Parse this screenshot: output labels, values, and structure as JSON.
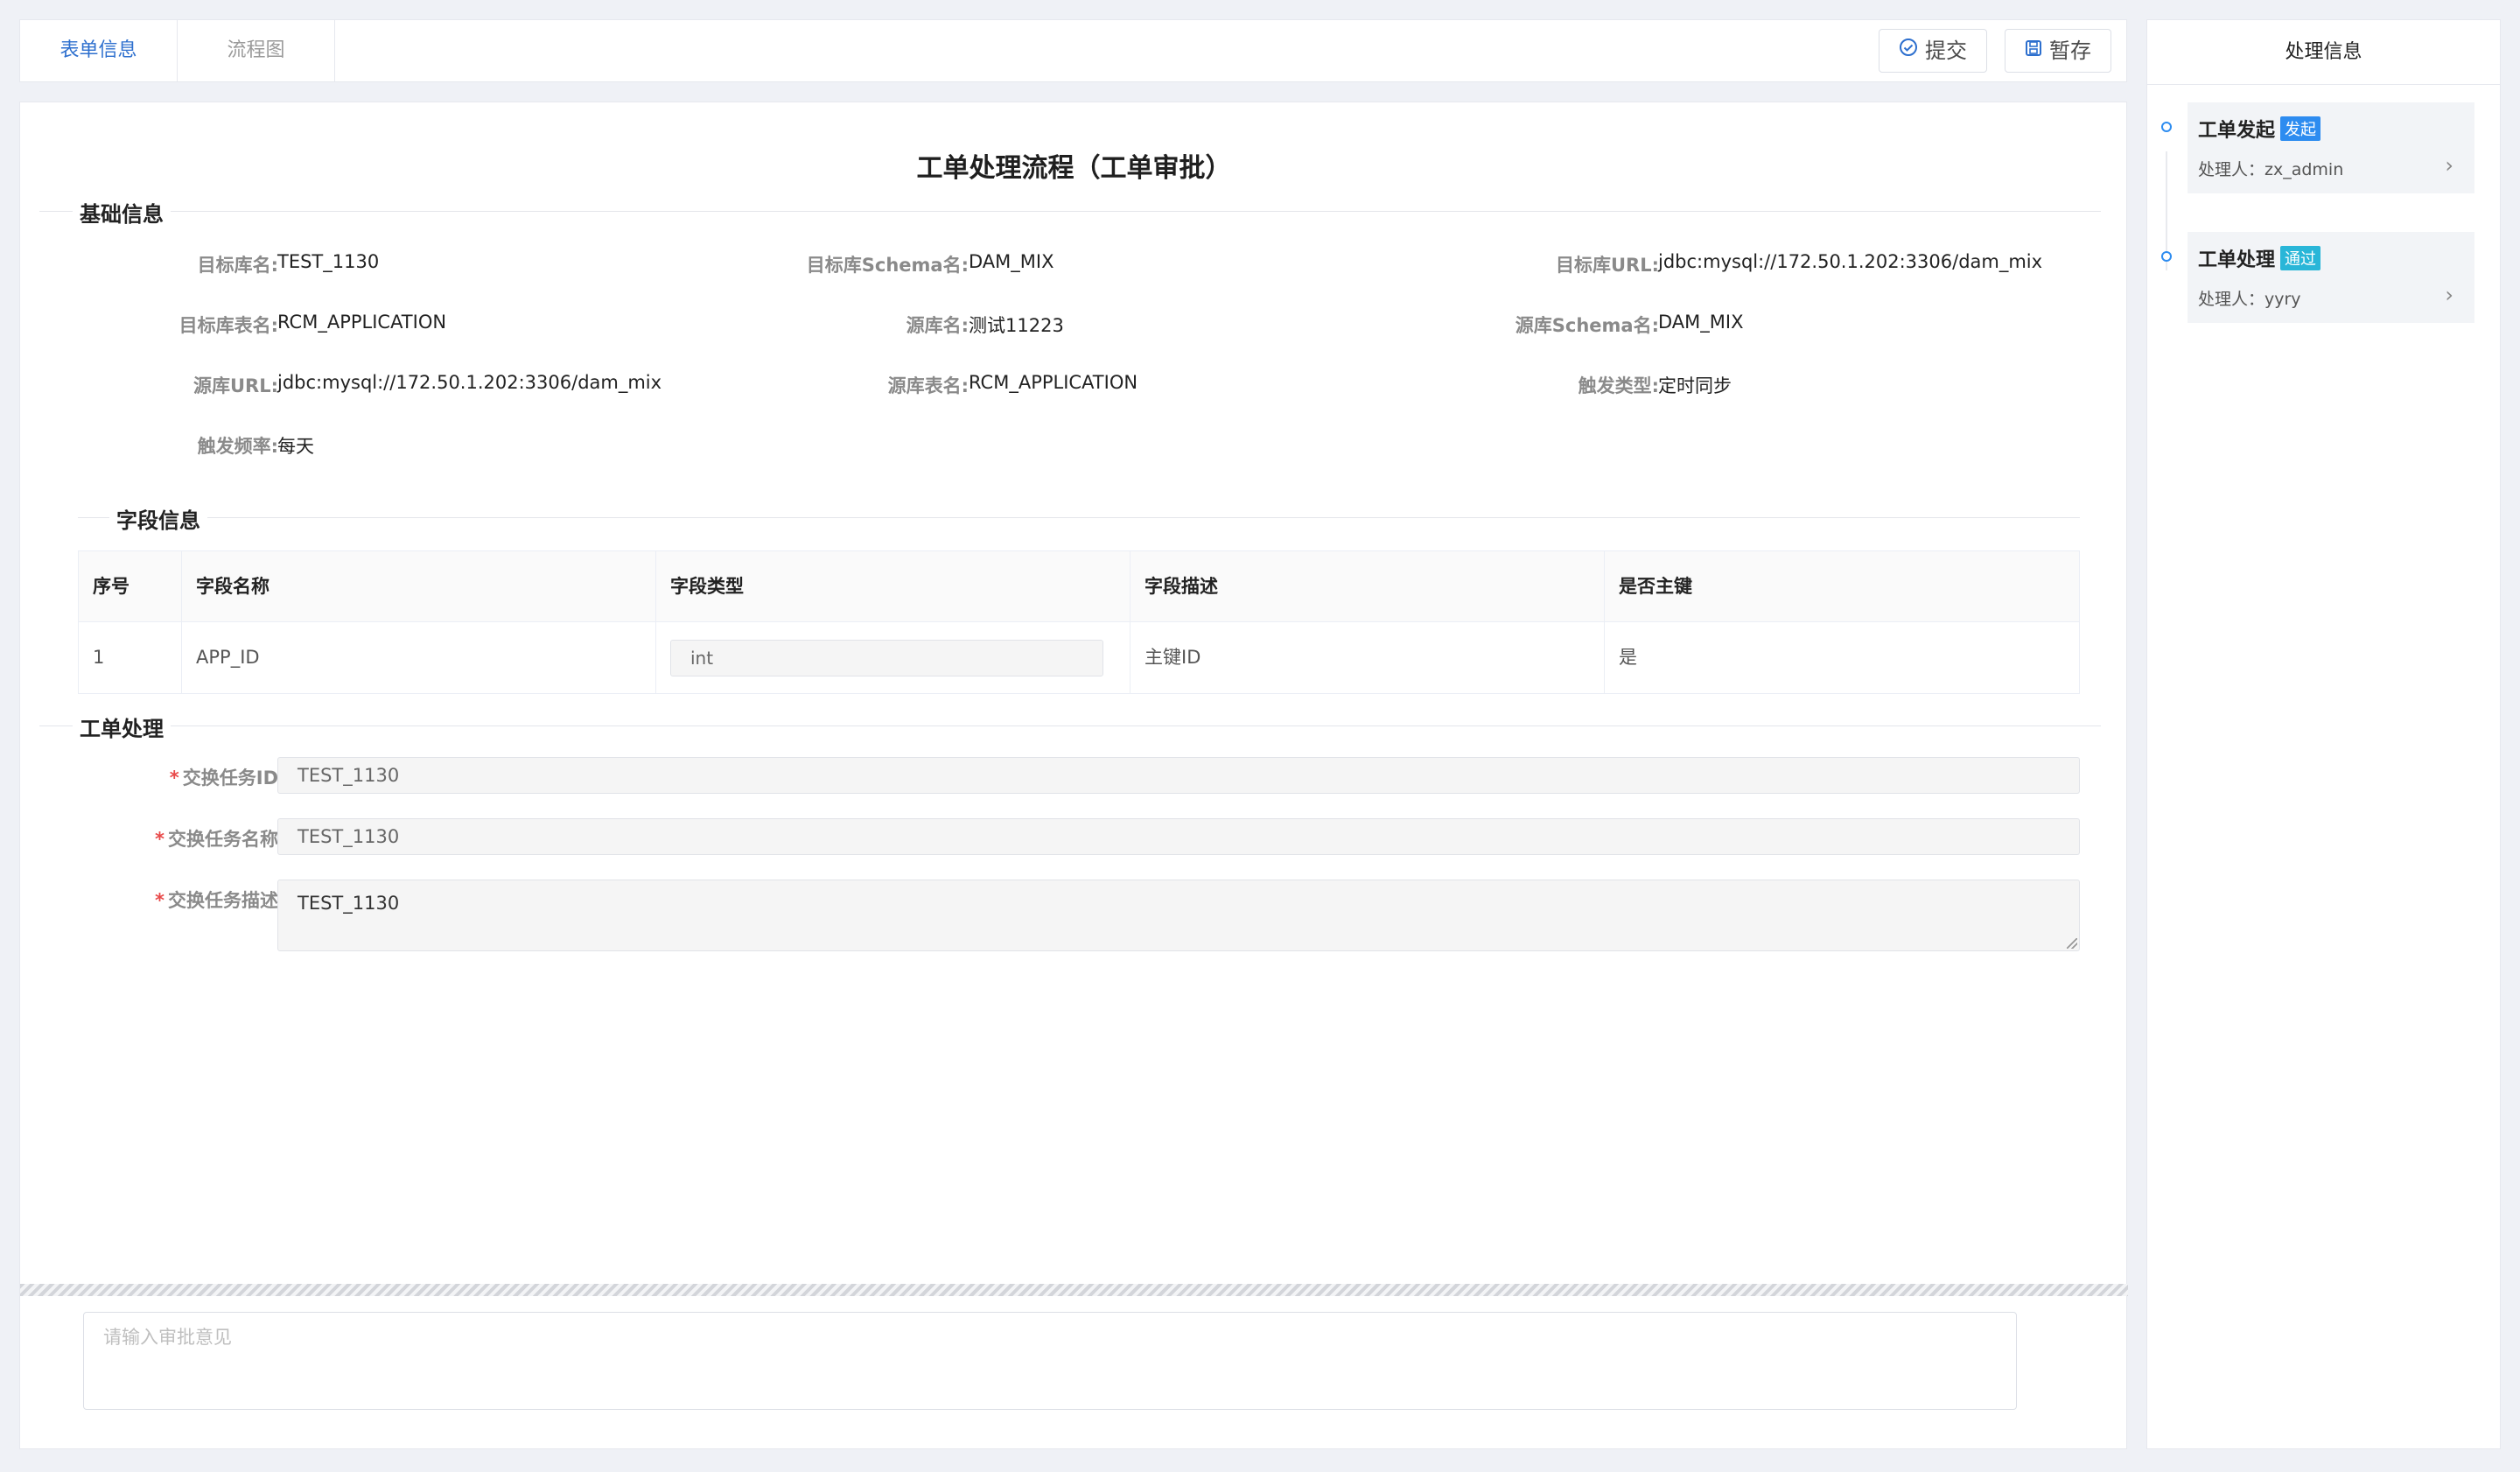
{
  "tabs": {
    "form_info": "表单信息",
    "flowchart": "流程图"
  },
  "toolbar": {
    "submit": "提交",
    "save_draft": "暂存",
    "submit_icon": "check-circle-icon",
    "save_icon": "save-icon"
  },
  "page": {
    "title": "工单处理流程（工单审批）"
  },
  "basic": {
    "section": "基础信息",
    "fields": [
      {
        "label": "目标库名:",
        "value": "TEST_1130"
      },
      {
        "label": "目标库Schema名:",
        "value": "DAM_MIX"
      },
      {
        "label": "目标库URL:",
        "value": "jdbc:mysql://172.50.1.202:3306/dam_mix"
      },
      {
        "label": "目标库表名:",
        "value": "RCM_APPLICATION"
      },
      {
        "label": "源库名:",
        "value": "测试11223"
      },
      {
        "label": "源库Schema名:",
        "value": "DAM_MIX"
      },
      {
        "label": "源库URL:",
        "value": "jdbc:mysql://172.50.1.202:3306/dam_mix"
      },
      {
        "label": "源库表名:",
        "value": "RCM_APPLICATION"
      },
      {
        "label": "触发类型:",
        "value": "定时同步"
      },
      {
        "label": "触发频率:",
        "value": "每天"
      }
    ]
  },
  "fields_section": {
    "section": "字段信息",
    "columns": [
      "序号",
      "字段名称",
      "字段类型",
      "字段描述",
      "是否主键"
    ],
    "rows": [
      {
        "no": "1",
        "name": "APP_ID",
        "type": "int",
        "desc": "主键ID",
        "pk": "是"
      }
    ]
  },
  "process": {
    "section": "工单处理",
    "task_id_label": "交换任务ID",
    "task_id_value": "TEST_1130",
    "task_name_label": "交换任务名称",
    "task_name_value": "TEST_1130",
    "task_desc_label": "交换任务描述",
    "task_desc_value": "TEST_1130",
    "required_mark": "*"
  },
  "opinion": {
    "placeholder": "请输入审批意见"
  },
  "side": {
    "title": "处理信息",
    "steps": [
      {
        "title": "工单发起",
        "badge": "发起",
        "badge_color": "#2d8cf0",
        "handler": "处理人：zx_admin"
      },
      {
        "title": "工单处理",
        "badge": "通过",
        "badge_color": "#29b6d8",
        "handler": "处理人：yyry"
      }
    ]
  }
}
